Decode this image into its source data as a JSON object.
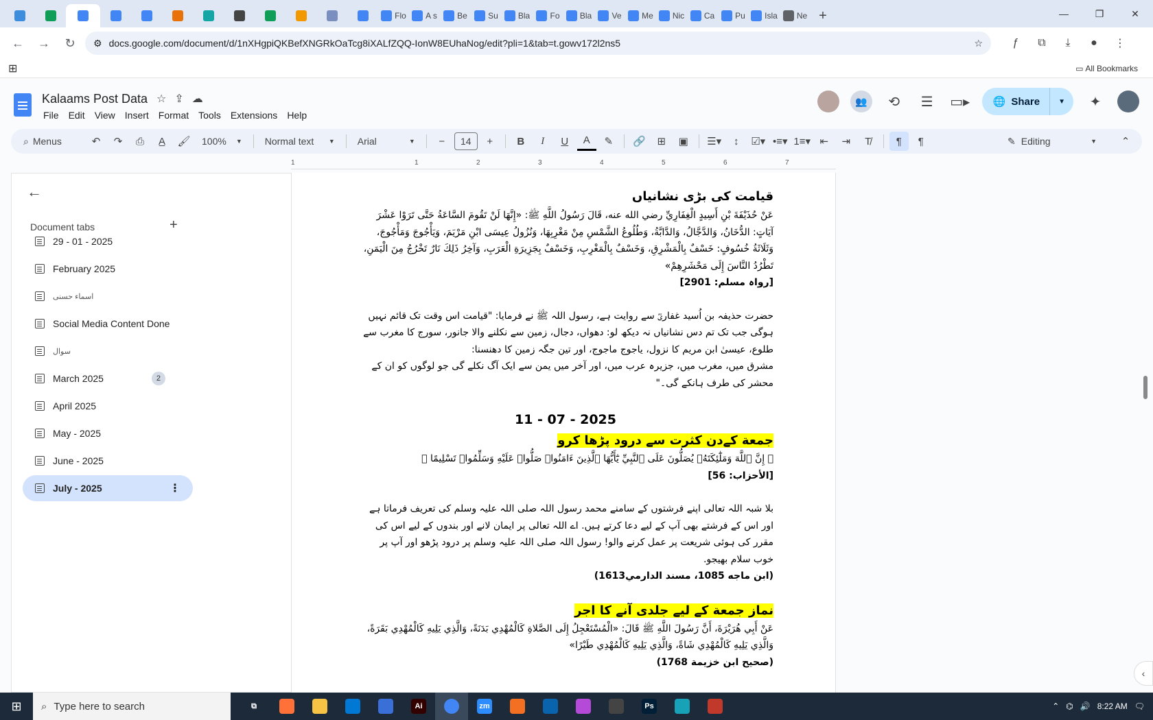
{
  "browser": {
    "tabs": [
      {
        "title": "",
        "color": "#3c8dde"
      },
      {
        "title": "",
        "color": "#0f9d58"
      },
      {
        "title": "",
        "color": "#4285f4",
        "active": true
      },
      {
        "title": "",
        "color": "#4285f4"
      },
      {
        "title": "",
        "color": "#4285f4"
      },
      {
        "title": "",
        "color": "#e8710a"
      },
      {
        "title": "",
        "color": "#16a5a5"
      },
      {
        "title": "",
        "color": "#444444"
      },
      {
        "title": "",
        "color": "#0f9d58"
      },
      {
        "title": "",
        "color": "#f29900"
      },
      {
        "title": "",
        "color": "#7a8fbf"
      },
      {
        "title": "",
        "color": "#4285f4"
      },
      {
        "title": "Flo",
        "color": "#4285f4"
      },
      {
        "title": "A s",
        "color": "#4285f4"
      },
      {
        "title": "Be",
        "color": "#4285f4"
      },
      {
        "title": "Su",
        "color": "#4285f4"
      },
      {
        "title": "Bla",
        "color": "#4285f4"
      },
      {
        "title": "Fo",
        "color": "#4285f4"
      },
      {
        "title": "Bla",
        "color": "#4285f4"
      },
      {
        "title": "Ve",
        "color": "#4285f4"
      },
      {
        "title": "Me",
        "color": "#4285f4"
      },
      {
        "title": "Nic",
        "color": "#4285f4"
      },
      {
        "title": "Ca",
        "color": "#4285f4"
      },
      {
        "title": "Pu",
        "color": "#4285f4"
      },
      {
        "title": "Isla",
        "color": "#4285f4"
      },
      {
        "title": "Ne",
        "color": "#5f6368"
      }
    ],
    "new_tab": "+",
    "url": "docs.google.com/document/d/1nXHgpiQKBefXNGRkOaTcg8iXALfZQQ-IonW8EUhaNog/edit?pli=1&tab=t.gowv172l2ns5",
    "all_bookmarks": "All Bookmarks"
  },
  "doc": {
    "title": "Kalaams Post Data",
    "menus": [
      "File",
      "Edit",
      "View",
      "Insert",
      "Format",
      "Tools",
      "Extensions",
      "Help"
    ],
    "share_label": "Share"
  },
  "toolbar": {
    "menus_placeholder": "Menus",
    "zoom": "100%",
    "style": "Normal text",
    "font": "Arial",
    "font_size": "14",
    "mode": "Editing"
  },
  "ruler": [
    "1",
    "1",
    "2",
    "3",
    "4",
    "5",
    "6",
    "7"
  ],
  "sidebar": {
    "heading": "Document tabs",
    "tabs": [
      {
        "label": "29 - 01 - 2025"
      },
      {
        "label": "February 2025"
      },
      {
        "label": "اسماء حسنى"
      },
      {
        "label": "Social Media Content Done"
      },
      {
        "label": "سوال"
      },
      {
        "label": "March 2025",
        "badge": "2"
      },
      {
        "label": "April 2025"
      },
      {
        "label": "May - 2025"
      },
      {
        "label": "June - 2025"
      },
      {
        "label": "July - 2025",
        "selected": true
      }
    ]
  },
  "content": {
    "heading1": "قیامت کی بڑی نشانیاں",
    "arabic1": "عَنْ حُذَيْفَةَ بْنِ أَسِيدٍ الْغِفَارِيِّ رضي الله عنه، قَالَ رَسُولُ اللَّهِ ﷺ: «إِنَّهَا لَنْ تَقُومَ السَّاعَةُ حَتَّى تَرَوْا عَشْرَ آيَاتٍ: الدُّخَانُ، وَالدَّجَّالُ، وَالدَّابَّةُ، وَطُلُوعُ الشَّمْسِ مِنْ مَغْرِبِهَا، وَنُزُولُ عِيسَى ابْنِ مَرْيَمَ، وَيَأْجُوجَ وَمَأْجُوجَ، وَثَلَاثَةُ خُسُوفٍ: خَسْفٌ بِالْمَشْرِقِ، وَخَسْفٌ بِالْمَغْرِبِ، وَخَسْفٌ بِجَزِيرَةِ الْعَرَبِ، وَآخِرُ ذَلِكَ نَارٌ تَخْرُجُ مِنَ الْيَمَنِ، تَطْرُدُ النَّاسَ إِلَى مَحْشَرِهِمْ»",
    "ref1": "[رواہ مسلم: 2901]",
    "urdu1": "حضرت حذیفہ بن اُسید غفاریؓ سے روایت ہے، رسول اللہ ﷺ نے فرمایا: \"قیامت اس وقت تک قائم نہیں ہوگی جب تک تم دس نشانیاں نہ دیکھ لو: دھواں، دجال، زمین سے نکلنے والا جانور، سورج کا مغرب سے طلوع، عیسیٰ ابن مریم کا نزول، یاجوج ماجوج، اور تین جگہ زمین کا دھنسنا:",
    "urdu1b": "مشرق میں، مغرب میں، جزیرہ عرب میں، اور آخر میں یمن سے ایک آگ نکلے گی جو لوگوں کو ان کے محشر کی طرف ہانکے گی۔\"",
    "date": "11 - 07 - 2025",
    "heading2": "جمعة کےدن کثرت سے درود پڑھا کرو",
    "quran": "﴿ إِنَّ ٱللَّهَ وَمَلَٰٓئِكَتَهُۥ يُصَلُّونَ عَلَى ٱلنَّبِيِّ يَٰٓأَيُّهَا ٱلَّذِينَ ءَامَنُوا۟ صَلُّوا۟ عَلَيْهِ وَسَلِّمُوا۟ تَسْلِيمًا ﴾",
    "ref2": "[الأحزاب: 56]",
    "urdu2": "بلا شبہ اللہ تعالی اپنے فرشتوں کے سامنے محمد رسول اللہ صلی اللہ علیہ وسلم کی تعریف فرماتا ہے اور اس کے فرشتے بھی آپ کے لیے دعا کرتے ہیں. اے اللہ تعالی پر ایمان لانے اور بندوں کے لیے اس کی مقرر کی ہوئی شریعت پر عمل کرنے والو! رسول اللہ صلی اللہ علیہ وسلم پر درود پڑھو اور آپ پر خوب سلام بھیجو.",
    "ref3": "(ابن ماجه 1085، مسند الدارمي1613)",
    "heading3": "نماز جمعة کے لیے جلدی آنے کا اجر",
    "arabic2": "عَنْ أَبِي هُرَيْرَةَ، أَنَّ رَسُولَ اللَّهِ ﷺ قَالَ: «الْمُسْتَعْجِلُ إِلَى الصَّلاةِ كَالْمُهْدِي بَدَنَةً، وَالَّذِي يَلِيهِ كَالْمُهْدِي بَقَرَةً، وَالَّذِي يَلِيهِ كَالْمُهْدِي شَاةً، وَالَّذِي يَلِيهِ كَالْمُهْدِي طَيْرًا»",
    "ref4": "(صحيح ابن خزيمة 1768)"
  },
  "taskbar": {
    "search_placeholder": "Type here to search",
    "apps": [
      "",
      "Ai",
      "",
      "zm",
      "",
      "",
      "",
      "",
      "Ps",
      "",
      ""
    ],
    "time": "8:22 AM"
  }
}
